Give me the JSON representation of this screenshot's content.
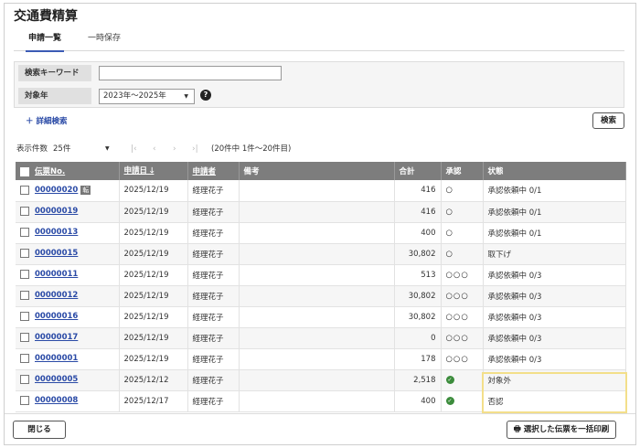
{
  "page": {
    "title": "交通費精算"
  },
  "tabs": [
    {
      "label": "申請一覧",
      "active": true
    },
    {
      "label": "一時保存",
      "active": false
    }
  ],
  "search": {
    "keyword_label": "検索キーワード",
    "keyword_value": "",
    "year_label": "対象年",
    "year_value": "2023年～2025年",
    "help_icon": "?",
    "advanced_label": "＋ 詳細検索",
    "search_button": "検索"
  },
  "pager": {
    "per_page_label": "表示件数",
    "per_page_value": "25件",
    "first": "|‹",
    "prev": "‹",
    "next": "›",
    "last": "›|",
    "count_text": "(20件中 1件～20件目)"
  },
  "table": {
    "headers": {
      "slip": "伝票No.",
      "date": "申請日",
      "sort_icon": "🡓",
      "applicant": "申請者",
      "note": "備考",
      "total": "合計",
      "approval": "承認",
      "status": "状態"
    },
    "rows": [
      {
        "slip": "00000020",
        "tag": "転",
        "date": "2025/12/19",
        "applicant": "経理花子",
        "note": "",
        "total": "416",
        "approval": "○",
        "approval_ok": false,
        "status": "承認依頼中 0/1"
      },
      {
        "slip": "00000019",
        "tag": "",
        "date": "2025/12/19",
        "applicant": "経理花子",
        "note": "",
        "total": "416",
        "approval": "○",
        "approval_ok": false,
        "status": "承認依頼中 0/1"
      },
      {
        "slip": "00000013",
        "tag": "",
        "date": "2025/12/19",
        "applicant": "経理花子",
        "note": "",
        "total": "400",
        "approval": "○",
        "approval_ok": false,
        "status": "承認依頼中 0/1"
      },
      {
        "slip": "00000015",
        "tag": "",
        "date": "2025/12/19",
        "applicant": "経理花子",
        "note": "",
        "total": "30,802",
        "approval": "○",
        "approval_ok": false,
        "status": "取下げ"
      },
      {
        "slip": "00000011",
        "tag": "",
        "date": "2025/12/19",
        "applicant": "経理花子",
        "note": "",
        "total": "513",
        "approval": "○○○",
        "approval_ok": false,
        "status": "承認依頼中 0/3"
      },
      {
        "slip": "00000012",
        "tag": "",
        "date": "2025/12/19",
        "applicant": "経理花子",
        "note": "",
        "total": "30,802",
        "approval": "○○○",
        "approval_ok": false,
        "status": "承認依頼中 0/3"
      },
      {
        "slip": "00000016",
        "tag": "",
        "date": "2025/12/19",
        "applicant": "経理花子",
        "note": "",
        "total": "30,802",
        "approval": "○○○",
        "approval_ok": false,
        "status": "承認依頼中 0/3"
      },
      {
        "slip": "00000017",
        "tag": "",
        "date": "2025/12/19",
        "applicant": "経理花子",
        "note": "",
        "total": "0",
        "approval": "○○○",
        "approval_ok": false,
        "status": "承認依頼中 0/3"
      },
      {
        "slip": "00000001",
        "tag": "",
        "date": "2025/12/19",
        "applicant": "経理花子",
        "note": "",
        "total": "178",
        "approval": "○○○",
        "approval_ok": false,
        "status": "承認依頼中 0/3"
      },
      {
        "slip": "00000005",
        "tag": "",
        "date": "2025/12/12",
        "applicant": "経理花子",
        "note": "",
        "total": "2,518",
        "approval": "✓",
        "approval_ok": true,
        "status": "対象外"
      },
      {
        "slip": "00000008",
        "tag": "",
        "date": "2025/12/17",
        "applicant": "経理花子",
        "note": "",
        "total": "400",
        "approval": "✓",
        "approval_ok": true,
        "status": "否認"
      }
    ]
  },
  "footer": {
    "close_button": "閉じる",
    "print_button": "選択した伝票を一括印刷",
    "print_icon": "🖶"
  },
  "colors": {
    "link": "#2a4aa6",
    "header_bg": "#7d7d7d",
    "highlight": "#f3df8a",
    "approved": "#3c8c3c"
  }
}
